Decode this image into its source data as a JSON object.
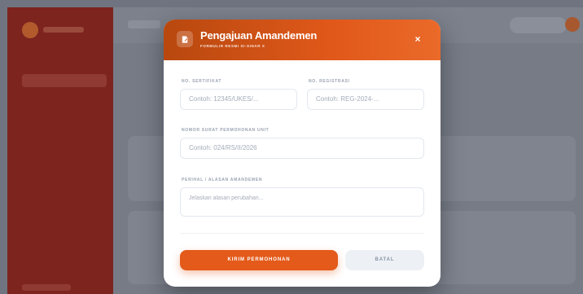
{
  "modal": {
    "title": "Pengajuan Amandemen",
    "subtitle": "FORMULIR RESMI SI-SINAR X",
    "close_symbol": "×",
    "icon": "edit-document-icon"
  },
  "form": {
    "certificate": {
      "label": "NO. SERTIFIKAT",
      "placeholder": "Contoh: 12345/UKES/..."
    },
    "registration": {
      "label": "NO. REGISTRASI",
      "placeholder": "Contoh: REG-2024-..."
    },
    "request_letter": {
      "label": "NOMOR SURAT PERMOHONAN UNIT",
      "placeholder": "Contoh: 024/RS/II/2026"
    },
    "reason": {
      "label": "PERIHAL / ALASAN AMANDEMEN",
      "placeholder": "Jelaskan alasan perubahan..."
    }
  },
  "actions": {
    "submit_label": "KIRIM PERMOHONAN",
    "cancel_label": "BATAL"
  },
  "colors": {
    "accent": "#e35a1a",
    "header_gradient_start": "#b8480f",
    "header_gradient_end": "#ea6a2a",
    "sidebar_dimmed": "#7d241f",
    "overlay": "#6f7480"
  }
}
